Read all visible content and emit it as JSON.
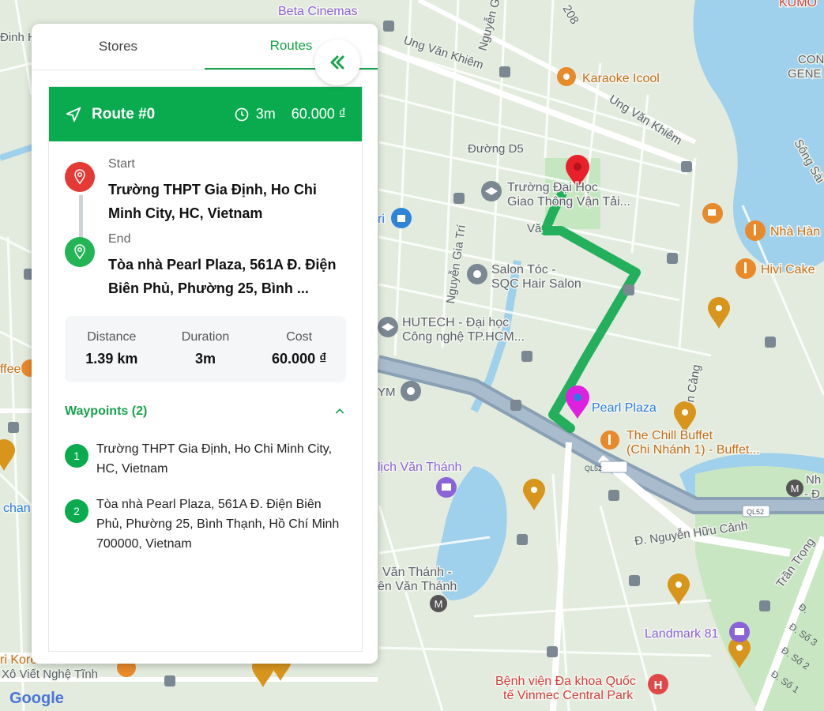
{
  "tabs": [
    {
      "label": "Stores",
      "active": false
    },
    {
      "label": "Routes",
      "active": true
    }
  ],
  "collapse_icon": "double-chevron-left-icon",
  "route": {
    "title": "Route #0",
    "duration": "3m",
    "cost": "60.000 ₫",
    "start_label": "Start",
    "start_address": "Trường THPT Gia Định, Ho Chi Minh City, HC, Vietnam",
    "end_label": "End",
    "end_address": "Tòa nhà Pearl Plaza, 561A Đ. Điện Biên Phủ, Phường 25, Bình ...",
    "stats": {
      "distance_label": "Distance",
      "distance": "1.39 km",
      "duration_label": "Duration",
      "duration": "3m",
      "cost_label": "Cost",
      "cost": "60.000 ₫"
    },
    "waypoints_header": "Waypoints (2)",
    "waypoints": [
      {
        "num": "1",
        "text": "Trường THPT Gia Định, Ho Chi Minh City, HC, Vietnam"
      },
      {
        "num": "2",
        "text": "Tòa nhà Pearl Plaza, 561A Đ. Điện Biên Phủ, Phường 25, Bình Thạnh, Hồ Chí Minh 700000, Vietnam"
      }
    ]
  },
  "colors": {
    "accent": "#0aab4f",
    "start": "#e53935",
    "end": "#22b455",
    "route_line": "#0fa84e",
    "destination_marker": "#e020e0"
  },
  "map": {
    "labels": {
      "beta": "Beta Cinemas",
      "ung_khiem": "Ung Văn Khiêm",
      "karaoke": "Karaoke Icool",
      "ung_khiem2": "Ung Văn Khiêm",
      "duong_d5": "Đường D5",
      "dh_gtvt1": "Trường Đại Học",
      "dh_gtvt2": "Giao Thông Vận Tải...",
      "salon1": "Salon Tóc -",
      "salon2": "SQC Hair Salon",
      "hutech1": "HUTECH - Đại học",
      "hutech2": "Công nghệ TP.HCM...",
      "pearl": "Pearl Plaza",
      "chill1": "The Chill Buffet",
      "chill2": "(Chi Nhánh 1) -  Buffet...",
      "van_thanh_lich": "lịch Văn Thánh",
      "van_thanh1": "Văn Thánh -",
      "van_thanh2": "ên Văn Thánh",
      "nguyen_huu_canh": "Đ. Nguyễn Hữu Cảnh",
      "tran_trong": "Trần Trọng",
      "landmark": "Landmark 81",
      "vinmec1": "Bệnh viện Đa khoa Quốc",
      "vinmec2": "tế Vinmec Central Park",
      "hivi": "Hivi Cake",
      "nha_hang": "Nhà Hàn",
      "song_sai": "Sông Sài",
      "kumo": "KUMO",
      "con_gen1": "CON",
      "con_gen2": "GENE",
      "nguyen_gia_tri": "Nguyễn Gia Trí",
      "koreanfood": "ri Korean ...",
      "xo_viet": "Xô Viết Nghệ Tĩnh",
      "google": "Google",
      "ql52a": "QL52",
      "ql52b": "QL52",
      "dinh_h": "Đinh H",
      "ym": "YM",
      "coffee": "ffee",
      "chan": "chan",
      "ri": "ri",
      "va": "Vă",
      "nguyen_top": "Nguyễn G",
      "n208": "208",
      "cang": "n Cảng",
      "nh": "Nh",
      "dd": "- Đ",
      "dso2": "Đ. Số 2",
      "dso3": "Đ. Số 3",
      "dso1": "Đ. Số 1",
      "d_top": "Đ.",
      "ung_kh_top": "Ung Văn Khiêm"
    }
  }
}
